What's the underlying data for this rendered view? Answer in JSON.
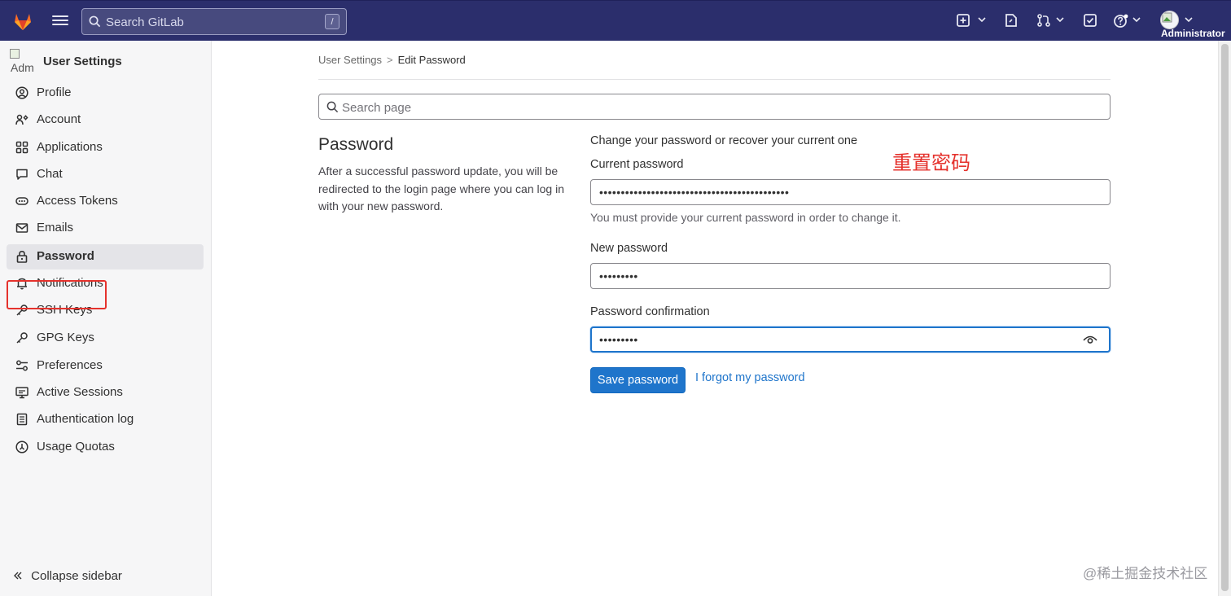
{
  "topbar": {
    "search_placeholder": "Search GitLab",
    "search_shortcut": "/",
    "username": "Administrator",
    "icons": [
      "gitlab-logo-icon",
      "hamburger-icon",
      "search-icon",
      "plus-square-icon",
      "issues-icon",
      "merge-request-icon",
      "todo-icon",
      "help-icon",
      "avatar"
    ]
  },
  "sidebar": {
    "avatar_alt": "Adm",
    "title": "User Settings",
    "items": [
      {
        "label": "Profile",
        "icon": "profile-icon"
      },
      {
        "label": "Account",
        "icon": "account-icon"
      },
      {
        "label": "Applications",
        "icon": "applications-icon"
      },
      {
        "label": "Chat",
        "icon": "chat-icon"
      },
      {
        "label": "Access Tokens",
        "icon": "token-icon"
      },
      {
        "label": "Emails",
        "icon": "email-icon"
      },
      {
        "label": "Password",
        "icon": "lock-icon",
        "active": true
      },
      {
        "label": "Notifications",
        "icon": "bell-icon"
      },
      {
        "label": "SSH Keys",
        "icon": "key-icon"
      },
      {
        "label": "GPG Keys",
        "icon": "key-icon"
      },
      {
        "label": "Preferences",
        "icon": "preferences-icon"
      },
      {
        "label": "Active Sessions",
        "icon": "monitor-icon"
      },
      {
        "label": "Authentication log",
        "icon": "log-icon"
      },
      {
        "label": "Usage Quotas",
        "icon": "quota-icon"
      }
    ],
    "collapse_label": "Collapse sidebar"
  },
  "breadcrumb": {
    "parent": "User Settings",
    "separator": ">",
    "current": "Edit Password"
  },
  "page_search": {
    "placeholder": "Search page"
  },
  "section": {
    "title": "Password",
    "description": "After a successful password update, you will be redirected to the login page where you can log in with your new password."
  },
  "form": {
    "intro": "Change your password or recover your current one",
    "current_label": "Current password",
    "current_value": "••••••••••••••••••••••••••••••••••••••••••••",
    "current_help": "You must provide your current password in order to change it.",
    "new_label": "New password",
    "new_value": "•••••••••",
    "confirm_label": "Password confirmation",
    "confirm_value": "•••••••••",
    "save_label": "Save password",
    "forgot_label": "I forgot my password"
  },
  "annotation": "重置密码",
  "watermark": "@稀土掘金技术社区",
  "colors": {
    "topbar": "#2b2e6c",
    "primary": "#1f75cb",
    "annotation": "#e5322d"
  }
}
